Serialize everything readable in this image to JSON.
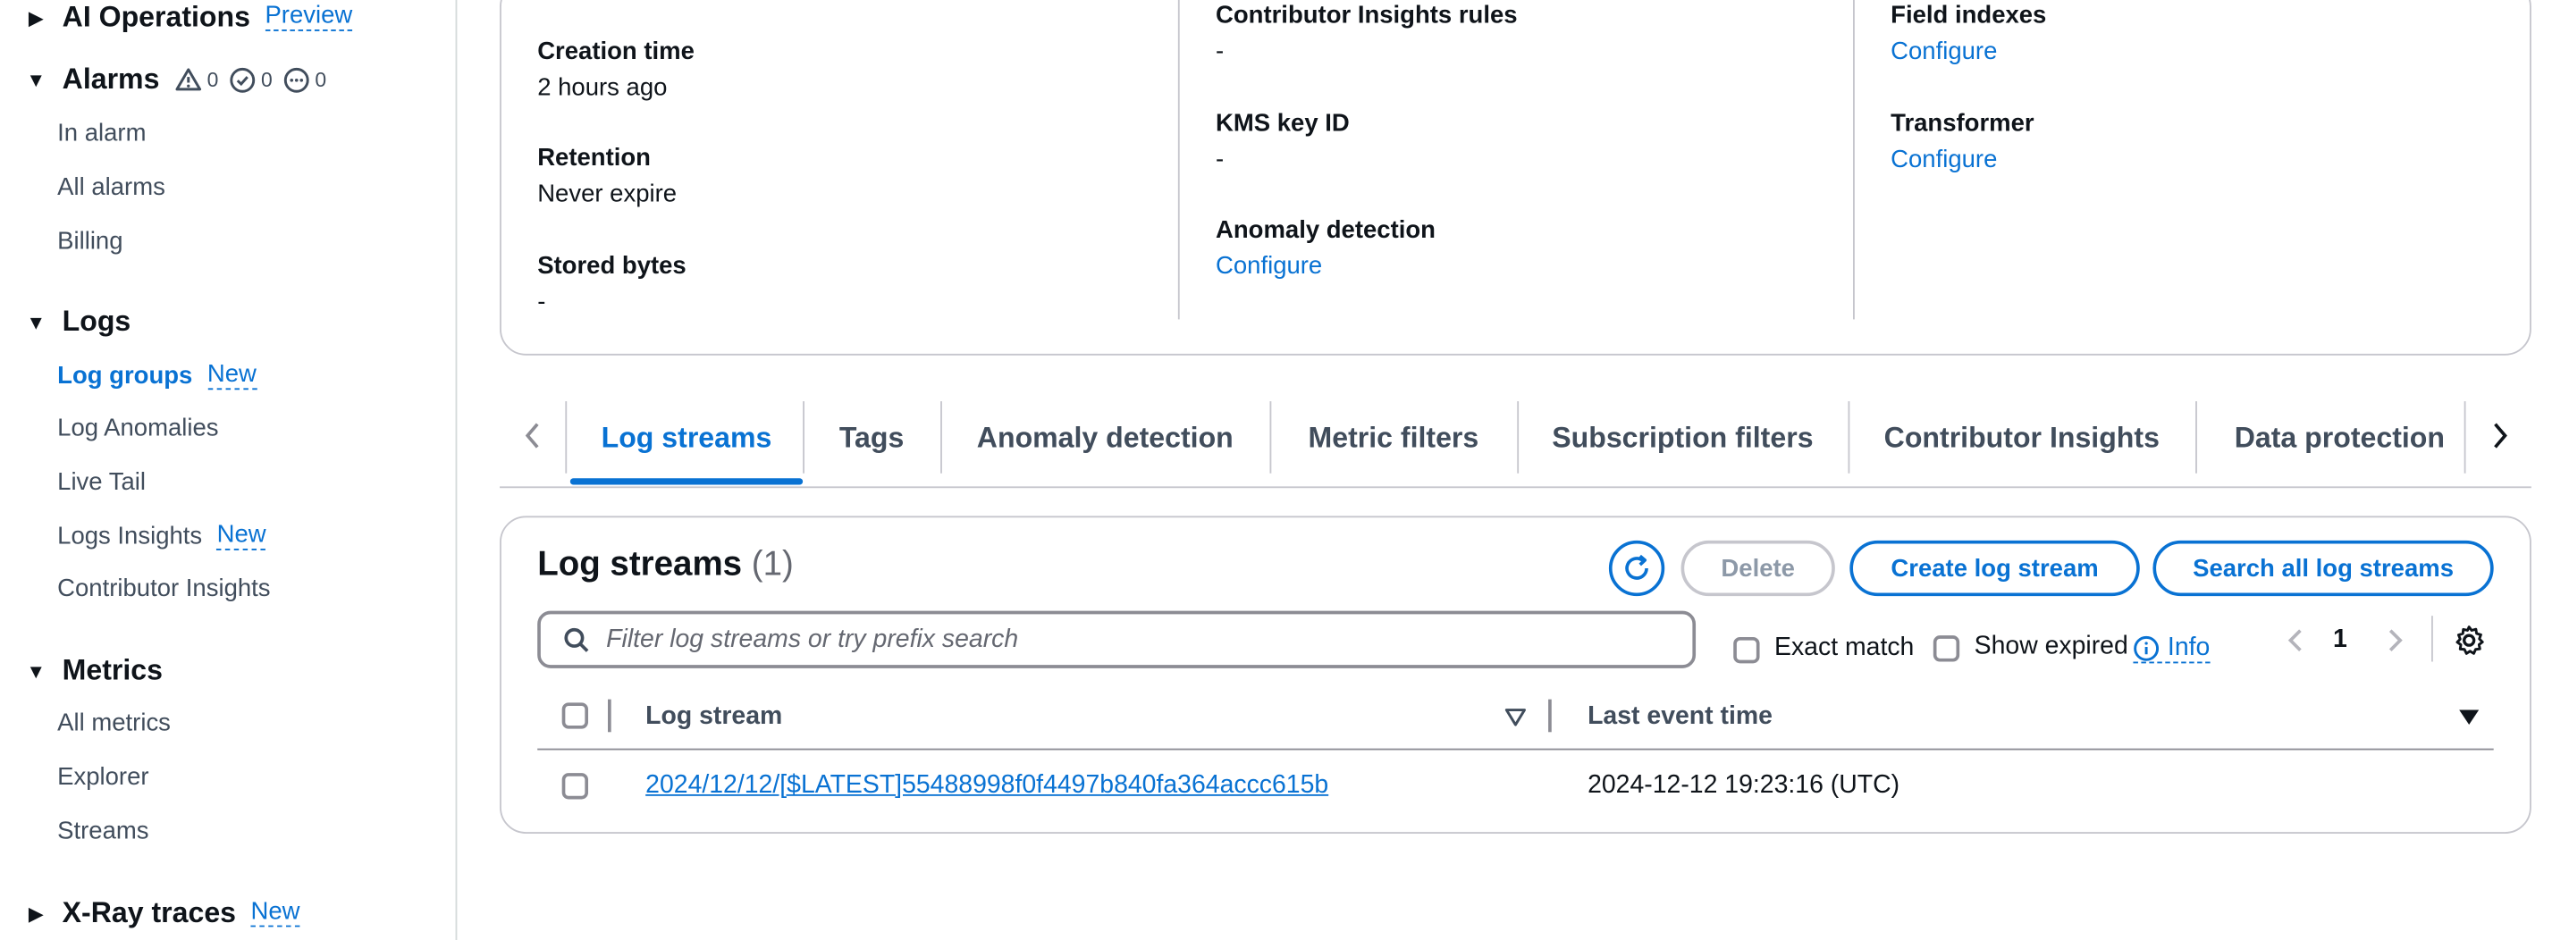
{
  "sidebar": {
    "ai_operations": {
      "label": "AI Operations",
      "badge": "Preview"
    },
    "alarms": {
      "label": "Alarms",
      "counts": {
        "in_alarm": "0",
        "ok": "0",
        "insufficient": "0"
      },
      "items": [
        "In alarm",
        "All alarms",
        "Billing"
      ]
    },
    "logs": {
      "label": "Logs",
      "items": [
        {
          "label": "Log groups",
          "badge": "New"
        },
        {
          "label": "Log Anomalies"
        },
        {
          "label": "Live Tail"
        },
        {
          "label": "Logs Insights",
          "badge": "New"
        },
        {
          "label": "Contributor Insights"
        }
      ]
    },
    "metrics": {
      "label": "Metrics",
      "items": [
        "All metrics",
        "Explorer",
        "Streams"
      ]
    },
    "xray": {
      "label": "X-Ray traces",
      "badge": "New"
    }
  },
  "details": {
    "creation_time": {
      "label": "Creation time",
      "value": "2 hours ago"
    },
    "retention": {
      "label": "Retention",
      "value": "Never expire"
    },
    "stored_bytes": {
      "label": "Stored bytes",
      "value": "-"
    },
    "contributor_rules": {
      "label": "Contributor Insights rules",
      "value": "-"
    },
    "kms_key": {
      "label": "KMS key ID",
      "value": "-"
    },
    "anomaly_detection": {
      "label": "Anomaly detection",
      "value": "Configure"
    },
    "field_indexes": {
      "label": "Field indexes",
      "value": "Configure"
    },
    "transformer": {
      "label": "Transformer",
      "value": "Configure"
    }
  },
  "tabs": [
    "Log streams",
    "Tags",
    "Anomaly detection",
    "Metric filters",
    "Subscription filters",
    "Contributor Insights",
    "Data protection"
  ],
  "streams": {
    "title": "Log streams",
    "count": "(1)",
    "delete_label": "Delete",
    "create_label": "Create log stream",
    "search_all_label": "Search all log streams",
    "search_placeholder": "Filter log streams or try prefix search",
    "exact_match_label": "Exact match",
    "show_expired_label": "Show expired",
    "info_label": "Info",
    "page": "1",
    "columns": [
      "Log stream",
      "Last event time"
    ],
    "rows": [
      {
        "stream": "2024/12/12/[$LATEST]55488998f0f4497b840fa364accc615b",
        "last_event": "2024-12-12 19:23:16 (UTC)"
      }
    ]
  },
  "colors": {
    "accent": "#0972d3",
    "text": "#0f141a",
    "muted": "#414d5c",
    "border": "#c6c6cd"
  }
}
